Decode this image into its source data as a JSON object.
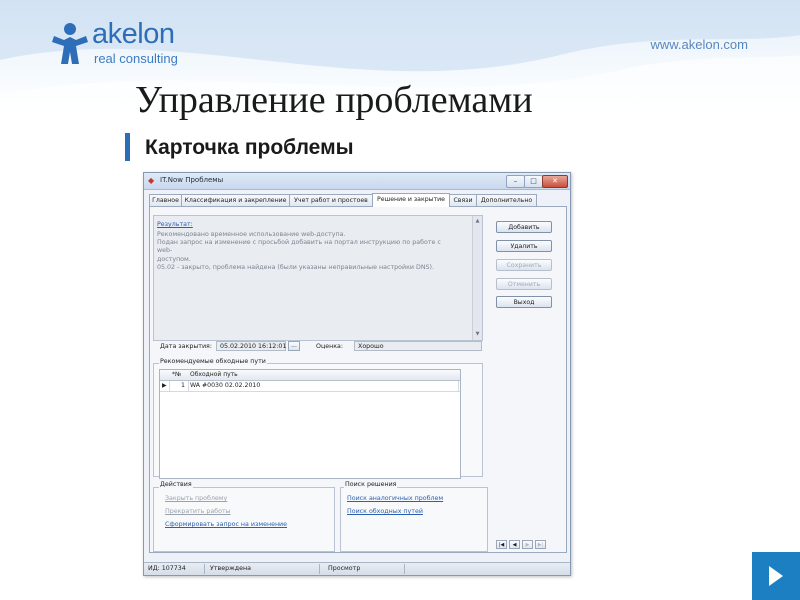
{
  "slide": {
    "logo_name": "akelon",
    "logo_sub": "real  consulting",
    "site_url": "www.akelon.com",
    "title": "Управление проблемами",
    "subtitle": "Карточка проблемы"
  },
  "window": {
    "title": "IT.Now Проблемы",
    "controls": {
      "minimize": "–",
      "maximize": "□",
      "close": "✕"
    },
    "tabs": [
      {
        "label": "Главное",
        "active": false
      },
      {
        "label": "Классификация и закрепление",
        "active": false
      },
      {
        "label": "Учет работ и простоев",
        "active": false
      },
      {
        "label": "Решение и закрытие",
        "active": true
      },
      {
        "label": "Связи",
        "active": false
      },
      {
        "label": "Дополнительно",
        "active": false
      }
    ],
    "result": {
      "label": "Результат:",
      "lines": [
        "Рекомендовано временное использование web-доступа.",
        "Подан запрос на изменение с просьбой добавить на портал инструкцию по работе с web-",
        "доступом.",
        "05.02 - закрыто, проблема найдена (были указаны неправильные настройки DNS)."
      ]
    },
    "close_date": {
      "label": "Дата закрытия:",
      "value": "05.02.2010 16:12:01",
      "picker": "..."
    },
    "rating": {
      "label": "Оценка:",
      "value": "Хорошо"
    },
    "workarounds": {
      "title": "Рекомендуемые обходные пути",
      "columns": [
        "*№",
        "Обходной путь"
      ],
      "rows": [
        {
          "num": "1",
          "path": "WA #0030 02.02.2010"
        }
      ]
    },
    "side_buttons": [
      {
        "label": "Добавить",
        "enabled": true
      },
      {
        "label": "Удалить",
        "enabled": true
      },
      {
        "label": "Сохранить",
        "enabled": false
      },
      {
        "label": "Отменить",
        "enabled": false
      },
      {
        "label": "Выход",
        "enabled": true
      }
    ],
    "actions": {
      "title": "Действия",
      "links": [
        {
          "label": "Закрыть проблему",
          "enabled": false
        },
        {
          "label": "Прекратить работы",
          "enabled": false
        },
        {
          "label": "Сформировать запрос на изменение",
          "enabled": true
        }
      ]
    },
    "search": {
      "title": "Поиск решения",
      "links": [
        {
          "label": "Поиск аналогичных проблем",
          "enabled": true
        },
        {
          "label": "Поиск обходных путей",
          "enabled": true
        }
      ]
    },
    "record_nav": [
      "|◀",
      "◀",
      "▶",
      "▶|"
    ],
    "status": {
      "id": "ИД: 107734",
      "state": "Утверждена",
      "mode": "Просмотр"
    }
  },
  "colors": {
    "brand_blue": "#2e6eb8",
    "link_blue": "#2d5fb0",
    "play_button": "#1b7fc1"
  }
}
